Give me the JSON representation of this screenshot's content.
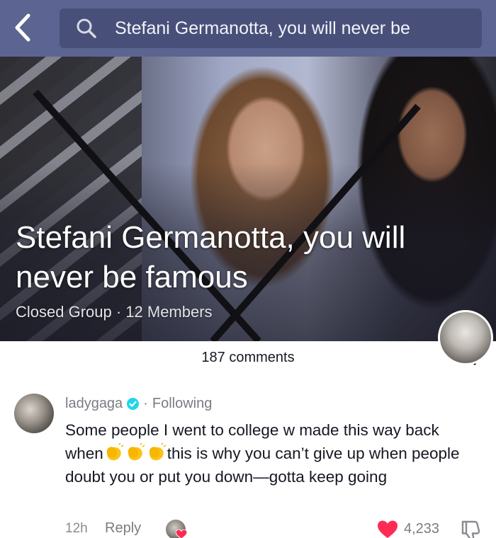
{
  "search": {
    "query": "Stefani Germanotta, you will never be"
  },
  "group": {
    "title": "Stefani Germanotta, you will never be famous",
    "meta": "Closed Group · 12 Members"
  },
  "sheet": {
    "title": "187 comments"
  },
  "comment": {
    "username": "ladygaga",
    "separator": "·",
    "following_label": "Following",
    "text_part1": "Some people I went to college w made this way back when",
    "text_part2": "this is why you can’t give up when people doubt you or put you down—gotta keep going",
    "timestamp": "12h",
    "reply_label": "Reply",
    "like_count": "4,233"
  },
  "colors": {
    "heart": "#fe2c55",
    "verified": "#20d5ec",
    "facebook_bar": "#5c6591"
  },
  "icons": [
    "back-arrow-icon",
    "search-icon",
    "close-icon",
    "verified-badge-icon",
    "clapping-hands-icon",
    "heart-icon",
    "dislike-icon"
  ]
}
